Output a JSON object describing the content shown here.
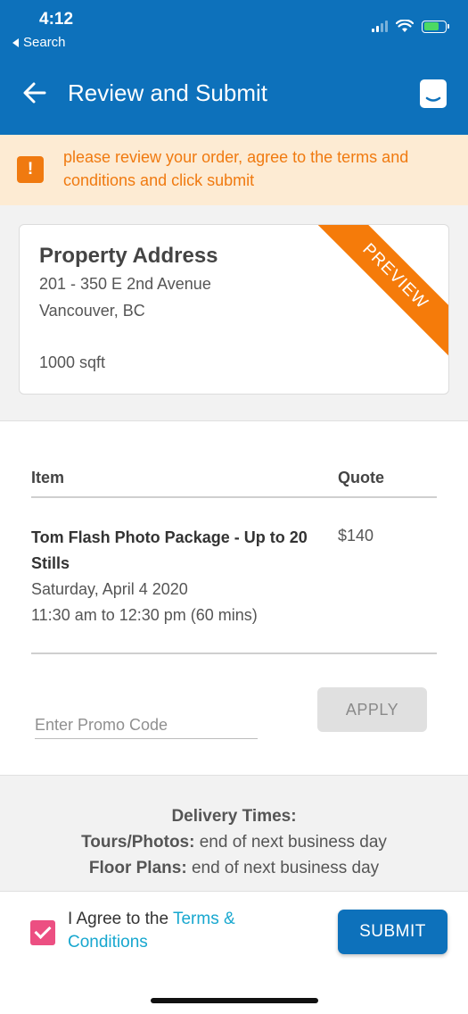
{
  "status_bar": {
    "time": "4:12",
    "back_label": "Search",
    "icons": [
      "signal-icon",
      "wifi-icon",
      "battery-charging-icon"
    ],
    "battery_level": 0.7
  },
  "header": {
    "title": "Review and Submit",
    "back_icon": "arrow-left-icon",
    "chat_icon": "chat-icon",
    "background": "#0d71bb"
  },
  "banner": {
    "icon": "alert-icon",
    "icon_glyph": "!",
    "message": "please review your order, agree to the terms and conditions and click submit",
    "color": "#f07a10"
  },
  "property": {
    "title": "Property Address",
    "address_line1": "201 - 350 E 2nd Avenue",
    "address_line2": "Vancouver, BC",
    "size": "1000 sqft",
    "ribbon": "PREVIEW"
  },
  "order": {
    "columns": {
      "item": "Item",
      "quote": "Quote"
    },
    "items": [
      {
        "name": "Tom Flash Photo Package - Up to 20 Stills",
        "date": "Saturday, April 4 2020",
        "time": "11:30 am to 12:30 pm (60 mins)",
        "quote": "$140"
      }
    ],
    "promo": {
      "placeholder": "Enter Promo Code",
      "value": "",
      "apply_label": "APPLY"
    }
  },
  "delivery": {
    "title": "Delivery Times:",
    "rows": [
      {
        "label": "Tours/Photos:",
        "value": "end of next business day"
      },
      {
        "label": "Floor Plans:",
        "value": "end of next business day"
      }
    ]
  },
  "footer": {
    "agree_checked": true,
    "agree_prefix": "I Agree to the",
    "agree_link": "Terms & Conditions",
    "submit_label": "SUBMIT"
  }
}
